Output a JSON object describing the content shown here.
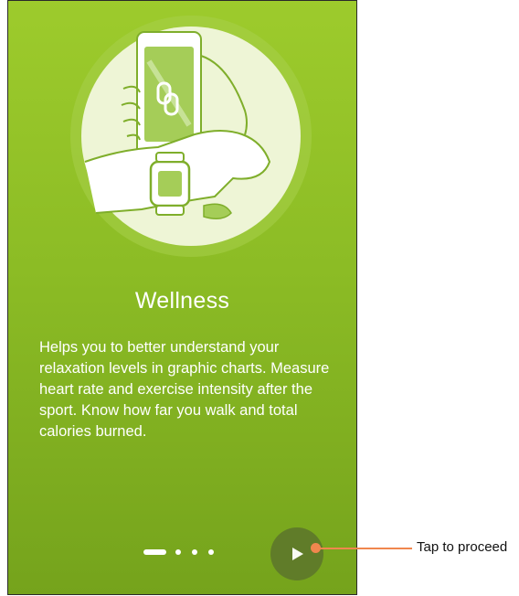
{
  "onboarding": {
    "title": "Wellness",
    "description": "Helps you to better understand your relaxation levels in graphic charts. Measure heart rate and exercise intensity after the sport. Know how far you walk and total calories burned.",
    "page_indicator": {
      "current": 1,
      "total": 4
    }
  },
  "annotation": {
    "label": "Tap to proceed"
  },
  "colors": {
    "background_top": "#9dcb2c",
    "background_bottom": "#75a31c",
    "illustration_circle": "#eef5d6",
    "next_button": "#5f7a2a",
    "callout": "#f0874e"
  }
}
